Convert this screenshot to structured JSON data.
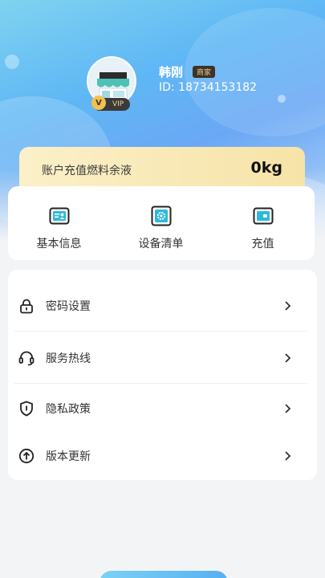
{
  "profile": {
    "name": "韩刚",
    "merchant_tag": "商家",
    "user_id": "ID: 18734153182",
    "vip_label": "VIP"
  },
  "fuel": {
    "label": "账户充值燃料余液",
    "value": "0kg"
  },
  "quick_actions": [
    {
      "label": "基本信息",
      "icon": "profile-card-icon"
    },
    {
      "label": "设备清单",
      "icon": "device-gear-icon"
    },
    {
      "label": "充值",
      "icon": "wallet-icon"
    }
  ],
  "menu": [
    {
      "label": "密码设置",
      "icon": "lock-icon"
    },
    {
      "label": "服务热线",
      "icon": "headset-icon"
    },
    {
      "label": "隐私政策",
      "icon": "shield-icon"
    },
    {
      "label": "版本更新",
      "icon": "upload-arrow-icon"
    }
  ],
  "colors": {
    "hero_blue": "#5fb7f5",
    "fuel_gold": "#f6e3a7",
    "quick_icon_teal": "#2fb8d8"
  }
}
